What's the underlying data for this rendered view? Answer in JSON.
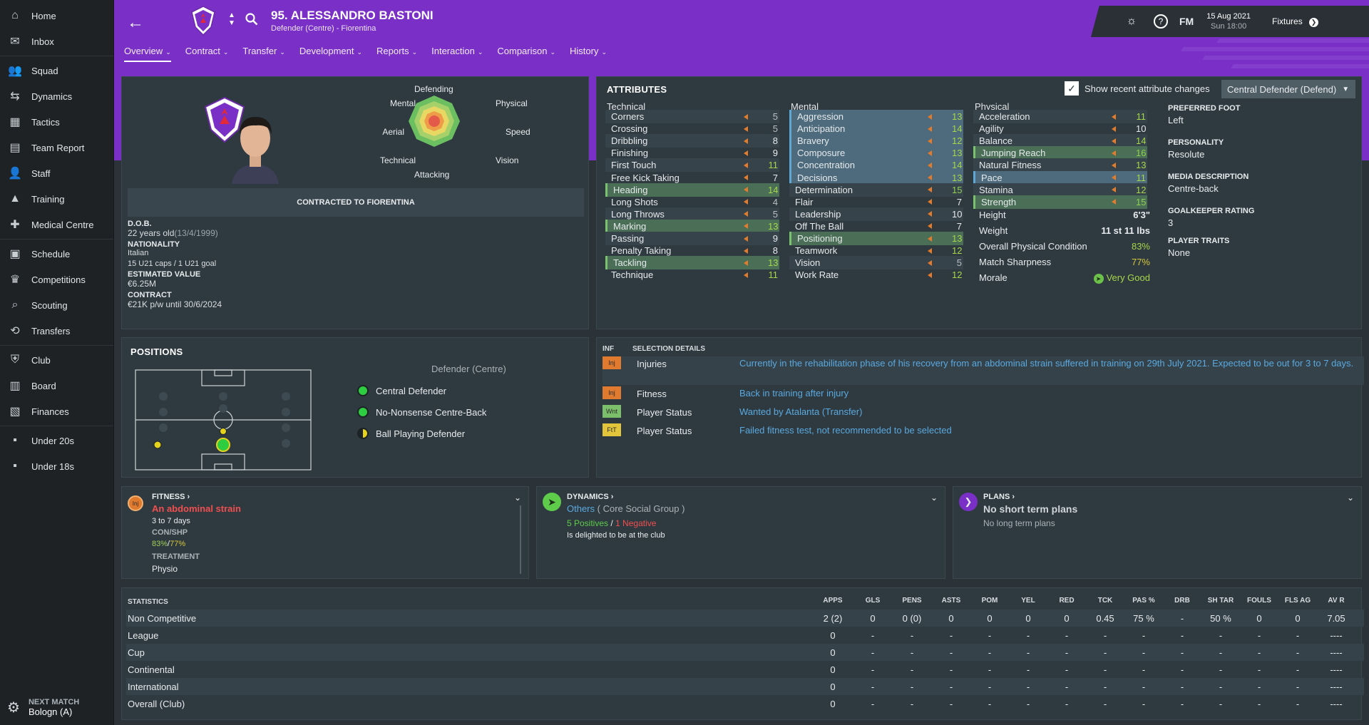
{
  "sidebar": {
    "items": [
      {
        "label": "Home",
        "icon": "home-icon"
      },
      {
        "label": "Inbox",
        "icon": "inbox-icon"
      },
      {
        "label": "Squad",
        "icon": "squad-icon"
      },
      {
        "label": "Dynamics",
        "icon": "dynamics-icon"
      },
      {
        "label": "Tactics",
        "icon": "tactics-icon"
      },
      {
        "label": "Team Report",
        "icon": "team-report-icon"
      },
      {
        "label": "Staff",
        "icon": "staff-icon"
      },
      {
        "label": "Training",
        "icon": "training-icon"
      },
      {
        "label": "Medical Centre",
        "icon": "medical-centre-icon"
      },
      {
        "label": "Schedule",
        "icon": "schedule-icon"
      },
      {
        "label": "Competitions",
        "icon": "trophy-icon"
      },
      {
        "label": "Scouting",
        "icon": "scouting-icon"
      },
      {
        "label": "Transfers",
        "icon": "transfers-icon"
      },
      {
        "label": "Club",
        "icon": "club-shield-icon"
      },
      {
        "label": "Board",
        "icon": "board-icon"
      },
      {
        "label": "Finances",
        "icon": "finances-icon"
      },
      {
        "label": "Under 20s",
        "icon": "u20-icon"
      },
      {
        "label": "Under 18s",
        "icon": "u18-icon"
      }
    ],
    "next_match_label": "NEXT MATCH",
    "next_match_value": "Bologn (A)"
  },
  "header": {
    "title": "95. ALESSANDRO BASTONI",
    "subtitle": "Defender (Centre) - Fiorentina",
    "date": "15 Aug 2021",
    "time": "Sun 18:00",
    "fm": "FM",
    "fixtures": "Fixtures",
    "accent": "#7a2fc6"
  },
  "tabs": [
    {
      "label": "Overview"
    },
    {
      "label": "Contract"
    },
    {
      "label": "Transfer"
    },
    {
      "label": "Development"
    },
    {
      "label": "Reports"
    },
    {
      "label": "Interaction"
    },
    {
      "label": "Comparison"
    },
    {
      "label": "History"
    }
  ],
  "profile": {
    "radar_labels": {
      "top": "Defending",
      "tl": "Mental",
      "tr": "Physical",
      "l": "Aerial",
      "r": "Speed",
      "bl": "Technical",
      "br": "Vision",
      "bottom": "Attacking"
    },
    "contracted": "CONTRACTED TO FIORENTINA",
    "dob_label": "D.O.B.",
    "dob": "22 years old",
    "dob_date": "(13/4/1999)",
    "nat_label": "NATIONALITY",
    "nat": "Italian",
    "caps": "15 U21 caps / 1 U21 goal",
    "value_label": "ESTIMATED VALUE",
    "value": "€6.25M",
    "contract_label": "CONTRACT",
    "contract": "€21K p/w until 30/6/2024"
  },
  "attributes": {
    "title": "ATTRIBUTES",
    "show_changes": "Show recent attribute changes",
    "role": "Central Defender (Defend)",
    "technical_label": "Technical",
    "mental_label": "Mental",
    "physical_label": "Physical",
    "technical": [
      {
        "name": "Corners",
        "value": "5"
      },
      {
        "name": "Crossing",
        "value": "5"
      },
      {
        "name": "Dribbling",
        "value": "8"
      },
      {
        "name": "Finishing",
        "value": "9"
      },
      {
        "name": "First Touch",
        "value": "11"
      },
      {
        "name": "Free Kick Taking",
        "value": "7"
      },
      {
        "name": "Heading",
        "value": "14"
      },
      {
        "name": "Long Shots",
        "value": "4"
      },
      {
        "name": "Long Throws",
        "value": "5"
      },
      {
        "name": "Marking",
        "value": "13"
      },
      {
        "name": "Passing",
        "value": "9"
      },
      {
        "name": "Penalty Taking",
        "value": "8"
      },
      {
        "name": "Tackling",
        "value": "13"
      },
      {
        "name": "Technique",
        "value": "11"
      }
    ],
    "mental": [
      {
        "name": "Aggression",
        "value": "13"
      },
      {
        "name": "Anticipation",
        "value": "14"
      },
      {
        "name": "Bravery",
        "value": "12"
      },
      {
        "name": "Composure",
        "value": "13"
      },
      {
        "name": "Concentration",
        "value": "14"
      },
      {
        "name": "Decisions",
        "value": "13"
      },
      {
        "name": "Determination",
        "value": "15"
      },
      {
        "name": "Flair",
        "value": "7"
      },
      {
        "name": "Leadership",
        "value": "10"
      },
      {
        "name": "Off The Ball",
        "value": "7"
      },
      {
        "name": "Positioning",
        "value": "13"
      },
      {
        "name": "Teamwork",
        "value": "12"
      },
      {
        "name": "Vision",
        "value": "5"
      },
      {
        "name": "Work Rate",
        "value": "12"
      }
    ],
    "physical": [
      {
        "name": "Acceleration",
        "value": "11"
      },
      {
        "name": "Agility",
        "value": "10"
      },
      {
        "name": "Balance",
        "value": "14"
      },
      {
        "name": "Jumping Reach",
        "value": "16"
      },
      {
        "name": "Natural Fitness",
        "value": "13"
      },
      {
        "name": "Pace",
        "value": "11"
      },
      {
        "name": "Stamina",
        "value": "12"
      },
      {
        "name": "Strength",
        "value": "15"
      }
    ],
    "info": [
      {
        "name": "Height",
        "value": "6'3\""
      },
      {
        "name": "Weight",
        "value": "11 st 11 lbs"
      },
      {
        "name": "Overall Physical Condition",
        "value": "83%"
      },
      {
        "name": "Match Sharpness",
        "value": "77%"
      },
      {
        "name": "Morale",
        "value": "Very Good"
      }
    ],
    "side": [
      {
        "label": "PREFERRED FOOT",
        "value": "Left"
      },
      {
        "label": "PERSONALITY",
        "value": "Resolute"
      },
      {
        "label": "MEDIA DESCRIPTION",
        "value": "Centre-back"
      },
      {
        "label": "GOALKEEPER RATING",
        "value": "3"
      },
      {
        "label": "PLAYER TRAITS",
        "value": "None"
      }
    ]
  },
  "positions": {
    "title": "POSITIONS",
    "main": "Defender (Centre)",
    "roles": [
      {
        "name": "Central Defender",
        "color": "#2ecc40"
      },
      {
        "name": "No-Nonsense Centre-Back",
        "color": "#2ecc40"
      },
      {
        "name": "Ball Playing Defender",
        "color": "#e6d21a"
      }
    ]
  },
  "selection": {
    "inf": "INF",
    "details": "SELECTION DETAILS",
    "rows": [
      {
        "badge": "Inj",
        "badge_color": "#e07a2e",
        "type": "Injuries",
        "text": "Currently in the rehabilitation phase of his recovery from an abdominal strain suffered in training on 29th July 2021. Expected to be out for 3 to 7 days."
      },
      {
        "badge": "Inj",
        "badge_color": "#e07a2e",
        "type": "Fitness",
        "text": "Back in training after injury"
      },
      {
        "badge": "Wnt",
        "badge_color": "#7bbf6a",
        "type": "Player Status",
        "text": "Wanted by Atalanta (Transfer)"
      },
      {
        "badge": "FtT",
        "badge_color": "#e2c53a",
        "type": "Player Status",
        "text": "Failed fitness test, not recommended to be selected"
      }
    ]
  },
  "fitness": {
    "title": "FITNESS",
    "badge": "Inj",
    "injury": "An abdominal strain",
    "duration": "3 to 7 days",
    "con_label": "CON/SHP",
    "con": "83%",
    "shp": "77%",
    "treat_label": "TREATMENT",
    "treat": "Physio"
  },
  "dynamics": {
    "title": "DYNAMICS",
    "group": "Others",
    "group_sub": "( Core Social Group )",
    "pos": "5 Positives",
    "neg": "1 Negative",
    "note": "Is delighted to be at the club"
  },
  "plans": {
    "title": "PLANS",
    "short": "No short term plans",
    "long": "No long term plans"
  },
  "stats": {
    "title": "STATISTICS",
    "columns": [
      "APPS",
      "GLS",
      "PENS",
      "ASTS",
      "POM",
      "YEL",
      "RED",
      "TCK",
      "PAS %",
      "DRB",
      "SH TAR",
      "FOULS",
      "FLS AG",
      "AV R"
    ],
    "rows": [
      {
        "name": "Non Competitive",
        "vals": [
          "2 (2)",
          "0",
          "0 (0)",
          "0",
          "0",
          "0",
          "0",
          "0.45",
          "75 %",
          "-",
          "50 %",
          "0",
          "0",
          "7.05"
        ]
      },
      {
        "name": "League",
        "vals": [
          "0",
          "-",
          "-",
          "-",
          "-",
          "-",
          "-",
          "-",
          "-",
          "-",
          "-",
          "-",
          "-",
          "----"
        ]
      },
      {
        "name": "Cup",
        "vals": [
          "0",
          "-",
          "-",
          "-",
          "-",
          "-",
          "-",
          "-",
          "-",
          "-",
          "-",
          "-",
          "-",
          "----"
        ]
      },
      {
        "name": "Continental",
        "vals": [
          "0",
          "-",
          "-",
          "-",
          "-",
          "-",
          "-",
          "-",
          "-",
          "-",
          "-",
          "-",
          "-",
          "----"
        ]
      },
      {
        "name": "International",
        "vals": [
          "0",
          "-",
          "-",
          "-",
          "-",
          "-",
          "-",
          "-",
          "-",
          "-",
          "-",
          "-",
          "-",
          "----"
        ]
      },
      {
        "name": "Overall (Club)",
        "vals": [
          "0",
          "-",
          "-",
          "-",
          "-",
          "-",
          "-",
          "-",
          "-",
          "-",
          "-",
          "-",
          "-",
          "----"
        ]
      }
    ]
  }
}
